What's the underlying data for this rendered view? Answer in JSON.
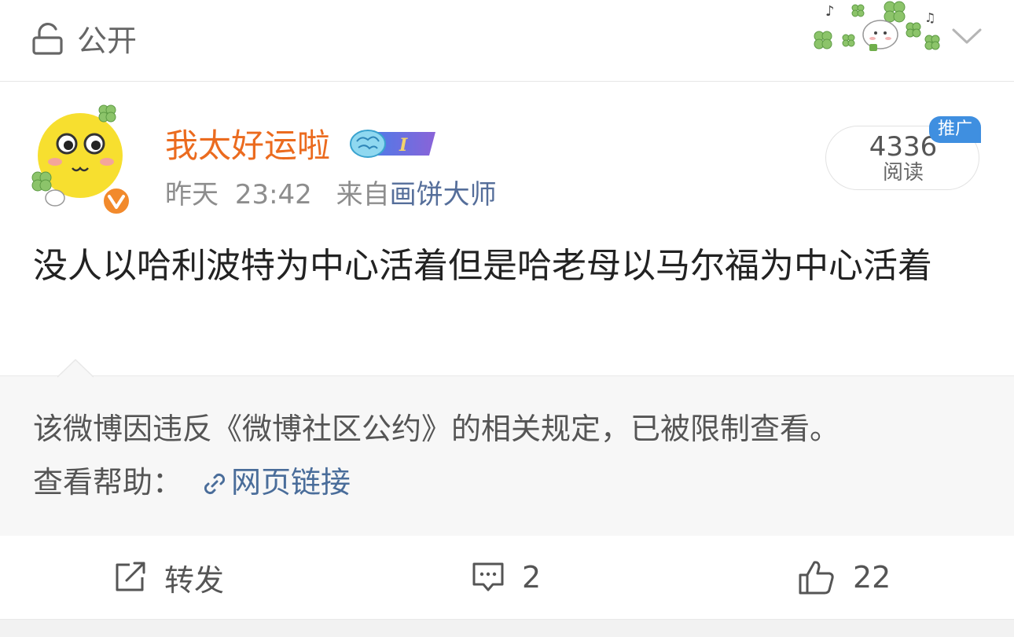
{
  "header": {
    "visibility_label": "公开",
    "icons": {
      "lock": "lock-icon",
      "decoration": "clover-sticker-decoration",
      "expand": "chevron-down-icon"
    }
  },
  "post": {
    "author": {
      "name": "我太好运啦",
      "badge_icon": "brain-badge-icon",
      "verified_icon": "orange-verified-icon"
    },
    "time_day": "昨天",
    "time_clock": "23:42",
    "from_label": "来自",
    "source": "画饼大师",
    "reads": {
      "count": "4336",
      "label": "阅读"
    },
    "promo_tag": "推广",
    "text": "没人以哈利波特为中心活着但是哈老母以马尔福为中心活着"
  },
  "notice": {
    "message": "该微博因违反《微博社区公约》的相关规定，已被限制查看。",
    "help_label": "查看帮助：",
    "link_label": "网页链接"
  },
  "actions": {
    "repost_label": "转发",
    "comment_count": "2",
    "like_count": "22"
  },
  "colors": {
    "username": "#eb6b1f",
    "link": "#4a6d9a",
    "promo": "#3f8fe0",
    "notice_bg": "#f7f7f7"
  }
}
